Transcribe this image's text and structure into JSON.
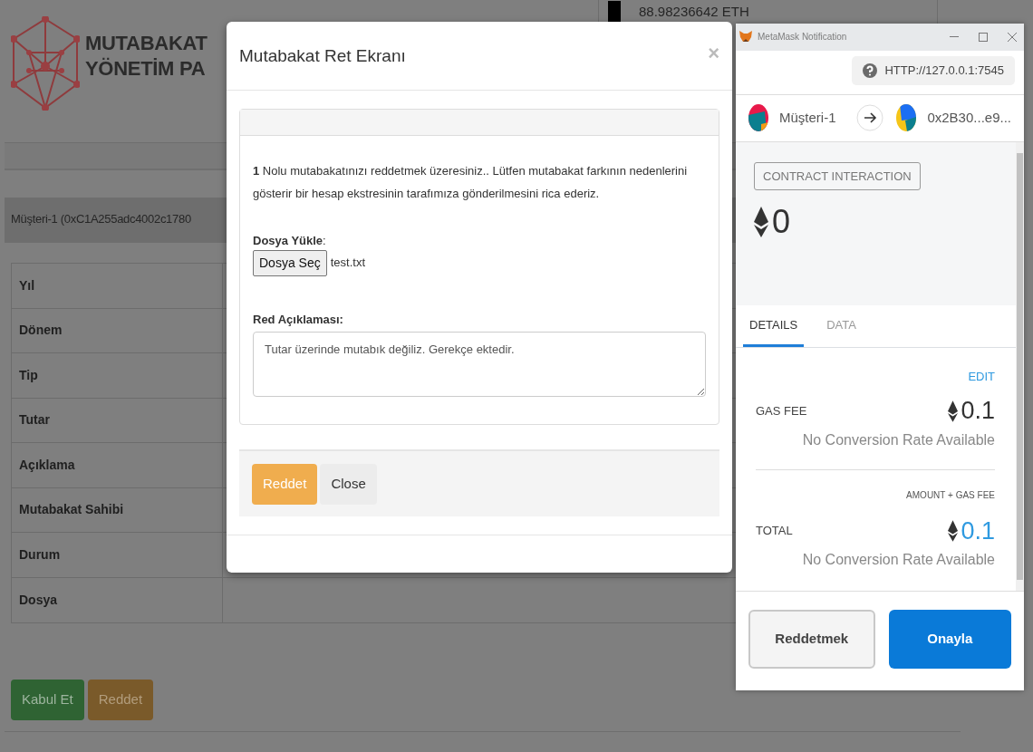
{
  "background_page": {
    "logo_lines": [
      "MUTABAKAT",
      "YÖNETİM PA"
    ],
    "balance": "88.98236642 ETH",
    "panel_title": "Müşteri-1 (0xC1A255adc4002c1780",
    "table_rows": [
      {
        "label": "Yıl"
      },
      {
        "label": "Dönem"
      },
      {
        "label": "Tip"
      },
      {
        "label": "Tutar"
      },
      {
        "label": "Açıklama"
      },
      {
        "label": "Mutabakat Sahibi"
      },
      {
        "label": "Durum"
      },
      {
        "label": "Dosya"
      }
    ],
    "buttons": [
      {
        "label": "Kabul Et",
        "kind": "success"
      },
      {
        "label": "Reddet",
        "kind": "warning"
      }
    ]
  },
  "modal": {
    "title": "Mutabakat Ret Ekranı",
    "close": "×",
    "message": "**1** Nolu mutabakatınızı reddetmek üzeresiniz.. Lütfen mutabakat farkının nedenlerini gösterir bir hesap ekstresinin tarafımıza gönderilmesini rica ederiz.",
    "file_label": "**Dosya Yükle**:",
    "file_button": "Dosya Seç",
    "file_name": "test.txt",
    "reason_label": "Red Açıklaması:",
    "reason_value": "Tutar üzerinde mutabık değiliz. Gerekçe ektedir.",
    "buttons": [
      {
        "label": "Reddet",
        "kind": "warning"
      },
      {
        "label": "Close",
        "kind": "default"
      }
    ]
  },
  "metamask": {
    "title": "MetaMask Notification",
    "origin": "HTTP://127.0.0.1:7545",
    "from": "Müşteri-1",
    "to": "0x2B30...e9...",
    "badge": "CONTRACT INTERACTION",
    "amount": "0",
    "tabs": [
      {
        "label": "DETAILS",
        "selected": true
      },
      {
        "label": "DATA",
        "selected": false
      }
    ],
    "edit": "EDIT",
    "gas_fee": {
      "label": "GAS FEE",
      "value": "0.1",
      "note": "No Conversion Rate Available"
    },
    "total": {
      "caption": "AMOUNT + GAS FEE",
      "label": "TOTAL",
      "value": "0.1",
      "note": "No Conversion Rate Available"
    },
    "buttons": [
      {
        "label": "Reddetmek",
        "kind": "secondary"
      },
      {
        "label": "Onayla",
        "kind": "primary"
      }
    ]
  }
}
